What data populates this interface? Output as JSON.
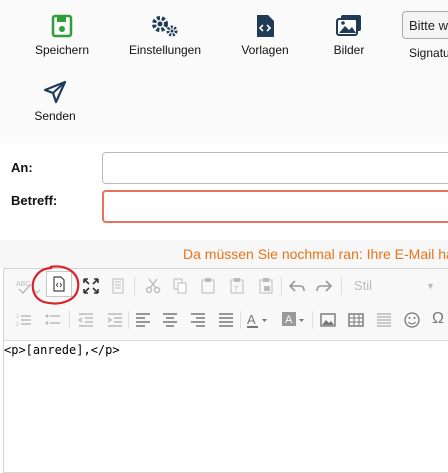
{
  "toolbar": {
    "save": "Speichern",
    "settings": "Einstellungen",
    "templates": "Vorlagen",
    "images": "Bilder",
    "select_value": "Bitte w",
    "signature": "Signatu",
    "send": "Senden"
  },
  "form": {
    "to_label": "An:",
    "subject_label": "Betreff:"
  },
  "alert": {
    "text": "Da müssen Sie nochmal ran: Ihre E-Mail ha"
  },
  "editor": {
    "style_label": "Stil",
    "content": "<p>[anrede],</p>"
  },
  "colors": {
    "save_icon": "#2e9e3a",
    "nav_icon": "#1f3b57",
    "alert": "#e8731a",
    "invalid_border": "#e8735a",
    "annotation": "#d8232a"
  }
}
